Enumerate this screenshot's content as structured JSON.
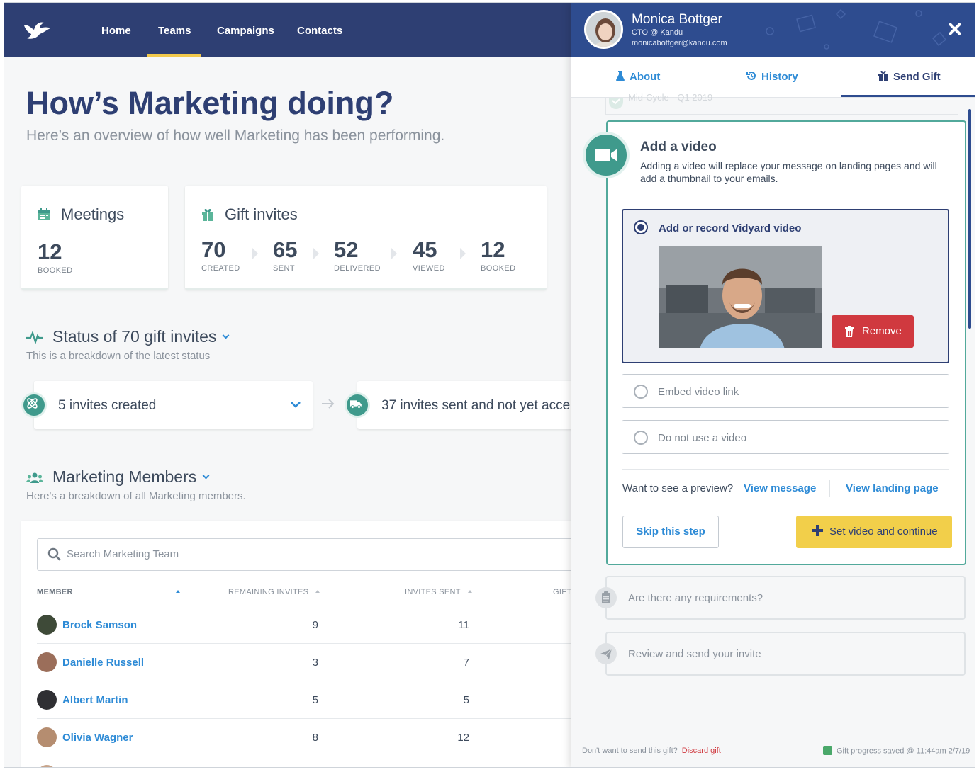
{
  "nav": {
    "items": [
      {
        "label": "Home"
      },
      {
        "label": "Teams"
      },
      {
        "label": "Campaigns"
      },
      {
        "label": "Contacts"
      }
    ],
    "active": "Teams"
  },
  "page": {
    "title": "How’s Marketing doing?",
    "subtitle": "Here’s an overview of how well Marketing has been performing."
  },
  "meetings": {
    "title": "Meetings",
    "value": "12",
    "label": "BOOKED"
  },
  "gift_invites": {
    "title": "Gift invites",
    "metrics": [
      {
        "value": "70",
        "label": "CREATED"
      },
      {
        "value": "65",
        "label": "SENT"
      },
      {
        "value": "52",
        "label": "DELIVERED"
      },
      {
        "value": "45",
        "label": "VIEWED"
      },
      {
        "value": "12",
        "label": "BOOKED"
      }
    ]
  },
  "status_section": {
    "title": "Status of 70 gift invites",
    "subtitle": "This is a breakdown of the latest status",
    "cards": [
      {
        "text": "5 invites created"
      },
      {
        "text": "37 invites sent and not yet accep"
      }
    ]
  },
  "members_section": {
    "title": "Marketing Members",
    "subtitle": "Here's a breakdown of all Marketing members.",
    "search_placeholder": "Search Marketing Team",
    "columns": [
      "MEMBER",
      "REMAINING INVITES",
      "INVITES SENT",
      "GIFT"
    ],
    "rows": [
      {
        "name": "Brock Samson",
        "remaining": "9",
        "sent": "11"
      },
      {
        "name": "Danielle Russell",
        "remaining": "3",
        "sent": "7"
      },
      {
        "name": "Albert Martin",
        "remaining": "5",
        "sent": "5"
      },
      {
        "name": "Olivia Wagner",
        "remaining": "8",
        "sent": "12"
      }
    ]
  },
  "drawer": {
    "contact": {
      "name": "Monica Bottger",
      "role": "CTO @ Kandu",
      "email": "monicabottger@kandu.com"
    },
    "tabs": [
      {
        "label": "About"
      },
      {
        "label": "History"
      },
      {
        "label": "Send Gift"
      }
    ],
    "active_tab": "Send Gift",
    "previous_step": "Mid-Cycle - Q1 2019",
    "video_step": {
      "title": "Add a video",
      "description": "Adding a video will replace your message on landing pages and will add a thumbnail to your emails.",
      "options": [
        {
          "label": "Add or record Vidyard video",
          "selected": true
        },
        {
          "label": "Embed video link",
          "selected": false
        },
        {
          "label": "Do not use a video",
          "selected": false
        }
      ],
      "remove_label": "Remove",
      "preview_question": "Want to see a preview?",
      "view_message": "View message",
      "view_landing": "View landing page",
      "skip_label": "Skip this step",
      "continue_label": "Set video and continue"
    },
    "next_steps": [
      {
        "label": "Are there any requirements?"
      },
      {
        "label": "Review and send your invite"
      }
    ],
    "footer": {
      "discard_prompt": "Don't want to send this gift?",
      "discard_label": "Discard gift",
      "saved_text": "Gift progress saved @ 11:44am 2/7/19"
    }
  },
  "colors": {
    "navy": "#2e3f73",
    "drawer_header": "#2e4c8f",
    "teal": "#3f9a8c",
    "link_blue": "#2e8bd6",
    "accent_yellow": "#f2cf4a",
    "danger_red": "#d0393f"
  },
  "icons": [
    "bird-logo-icon",
    "calendar-icon",
    "gift-icon",
    "pulse-icon",
    "atom-icon",
    "truck-icon",
    "users-icon",
    "search-icon",
    "flask-icon",
    "history-icon",
    "video-camera-icon",
    "trash-icon",
    "plus-icon",
    "clipboard-icon",
    "paper-plane-icon",
    "save-icon",
    "close-icon",
    "check-icon"
  ]
}
